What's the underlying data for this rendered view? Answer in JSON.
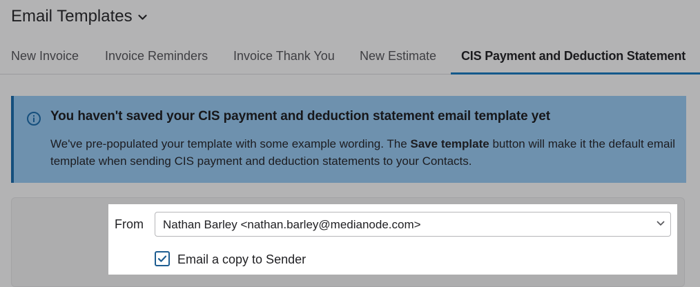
{
  "header": {
    "title": "Email Templates",
    "tabs": [
      {
        "label": "New Invoice"
      },
      {
        "label": "Invoice Reminders"
      },
      {
        "label": "Invoice Thank You"
      },
      {
        "label": "New Estimate"
      },
      {
        "label": "CIS Payment and Deduction Statement",
        "active": true
      }
    ]
  },
  "notice": {
    "icon": "info-icon",
    "title": "You haven't saved your CIS payment and deduction statement email template yet",
    "body_before": "We've pre-populated your template with some example wording. The ",
    "body_bold": "Save template",
    "body_after": " button will make it the default email template when sending CIS payment and deduction statements to your Contacts."
  },
  "form": {
    "from_label": "From",
    "from_value": "Nathan Barley <nathan.barley@medianode.com>",
    "copy_label": "Email a copy to Sender",
    "copy_checked": true
  },
  "colors": {
    "accent": "#14598b",
    "notice_bg": "#6e91ae",
    "overlay": "#b3b3b4"
  }
}
